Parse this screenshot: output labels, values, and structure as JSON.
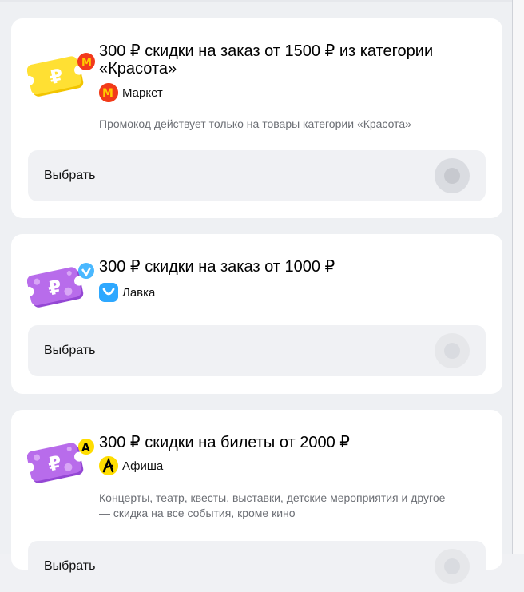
{
  "offers": [
    {
      "title": "300 ₽ скидки на заказ от 1500 ₽ из категории «Красота»",
      "service": "Маркет",
      "service_icon": "market-logo-icon",
      "description": "Промокод действует только на товары категории «Красота»",
      "button_label": "Выбрать",
      "coupon_color": "#ffe033",
      "selected": false
    },
    {
      "title": "300 ₽ скидки на заказ от 1000 ₽",
      "service": "Лавка",
      "service_icon": "lavka-logo-icon",
      "description": "",
      "button_label": "Выбрать",
      "coupon_color": "#b46be8",
      "selected": false
    },
    {
      "title": "300 ₽ скидки на билеты от 2000 ₽",
      "service": "Афиша",
      "service_icon": "afisha-logo-icon",
      "description": "Концерты, театр, квесты, выставки, детские мероприятия и другое — скидка на все события, кроме кино",
      "button_label": "Выбрать",
      "coupon_color": "#b46be8",
      "selected": false
    }
  ]
}
